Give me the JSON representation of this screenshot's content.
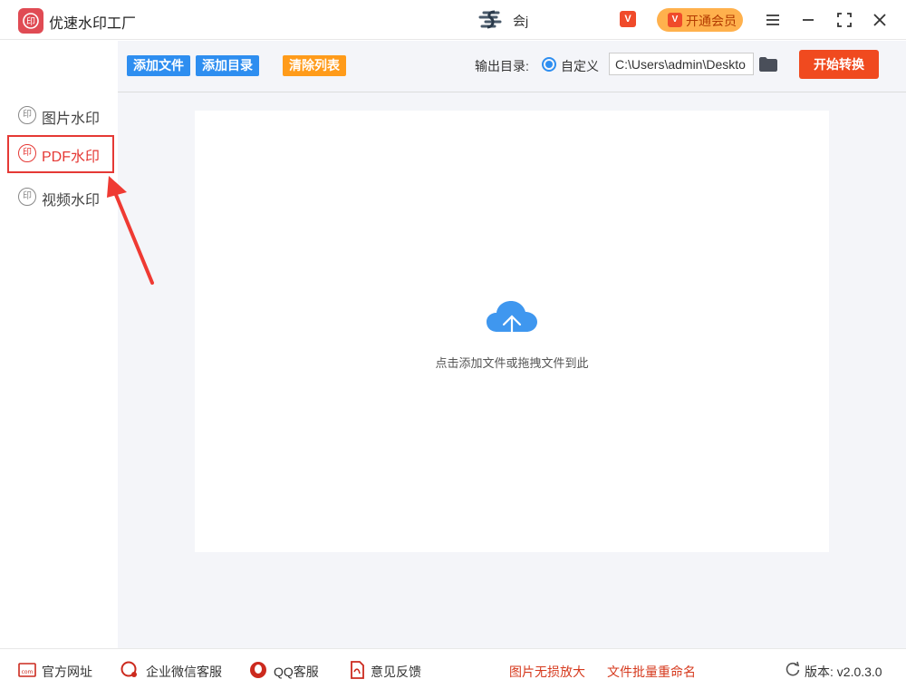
{
  "titlebar": {
    "app_title": "优速水印工厂",
    "user_name": "会j",
    "vip_badge": "V",
    "vip_label": "开通会员"
  },
  "sidebar": {
    "items": [
      {
        "label": "图片水印",
        "icon_glyph": "印",
        "active": false
      },
      {
        "label": "PDF水印",
        "icon_glyph": "印",
        "active": true
      },
      {
        "label": "视频水印",
        "icon_glyph": "印",
        "active": false
      }
    ]
  },
  "toolbar": {
    "add_file": "添加文件",
    "add_dir": "添加目录",
    "clear_list": "清除列表",
    "output_label": "输出目录:",
    "radio_label": "自定义",
    "output_path": "C:\\Users\\admin\\Deskto",
    "start": "开始转换"
  },
  "main": {
    "drop_text": "点击添加文件或拖拽文件到此"
  },
  "footer": {
    "website": "官方网址",
    "wechat": "企业微信客服",
    "qq": "QQ客服",
    "feedback": "意见反馈",
    "enlarge": "图片无损放大",
    "rename": "文件批量重命名",
    "version": "版本: v2.0.3.0"
  },
  "colors": {
    "accent_blue": "#2e8ef0",
    "accent_orange": "#ff9b1a",
    "start_red": "#f04a1f",
    "active_red": "#e53935",
    "vip_gold": "#ffb14d"
  },
  "icons": {
    "app": "stamp-logo-icon",
    "user": "user-logo-icon",
    "menu": "hamburger-icon",
    "minimize": "minimize-icon",
    "maximize": "maximize-icon",
    "close": "close-icon",
    "folder": "folder-icon",
    "upload": "cloud-upload-icon",
    "refresh": "refresh-icon"
  }
}
